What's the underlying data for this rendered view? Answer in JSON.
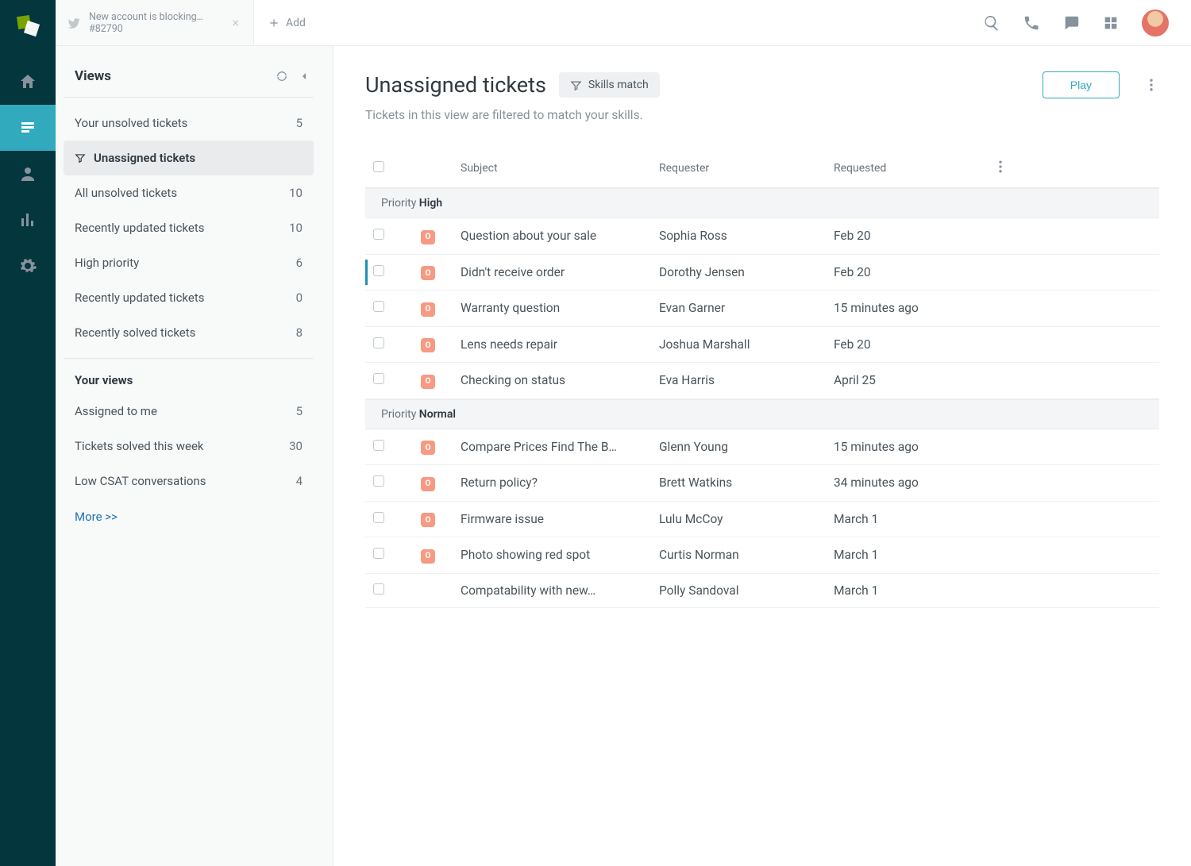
{
  "tab": {
    "title": "New account is blocking…",
    "subtitle": "#82790",
    "add_label": "Add"
  },
  "views_panel": {
    "heading": "Views",
    "system_views": [
      {
        "label": "Your unsolved tickets",
        "count": "5",
        "selected": false,
        "icon": false
      },
      {
        "label": "Unassigned tickets",
        "count": "",
        "selected": true,
        "icon": true
      },
      {
        "label": "All unsolved tickets",
        "count": "10",
        "selected": false,
        "icon": false
      },
      {
        "label": "Recently updated tickets",
        "count": "10",
        "selected": false,
        "icon": false
      },
      {
        "label": "High priority",
        "count": "6",
        "selected": false,
        "icon": false
      },
      {
        "label": "Recently updated tickets",
        "count": "0",
        "selected": false,
        "icon": false
      },
      {
        "label": "Recently solved tickets",
        "count": "8",
        "selected": false,
        "icon": false
      }
    ],
    "your_views_heading": "Your views",
    "your_views": [
      {
        "label": "Assigned to me",
        "count": "5"
      },
      {
        "label": "Tickets solved this week",
        "count": "30"
      },
      {
        "label": "Low CSAT conversations",
        "count": "4"
      }
    ],
    "more_label": "More >>"
  },
  "main": {
    "title": "Unassigned tickets",
    "skills_label": "Skills match",
    "play_label": "Play",
    "subtitle": "Tickets in this view are filtered to match your skills.",
    "columns": {
      "subject": "Subject",
      "requester": "Requester",
      "requested": "Requested"
    },
    "priority_label": "Priority",
    "groups": [
      {
        "name": "High",
        "rows": [
          {
            "badge": "O",
            "subject": "Question about your sale",
            "requester": "Sophia Ross",
            "requested": "Feb 20",
            "marked": false
          },
          {
            "badge": "O",
            "subject": "Didn't receive order",
            "requester": "Dorothy Jensen",
            "requested": "Feb 20",
            "marked": true
          },
          {
            "badge": "O",
            "subject": "Warranty question",
            "requester": "Evan Garner",
            "requested": "15 minutes ago",
            "marked": false
          },
          {
            "badge": "O",
            "subject": "Lens needs repair",
            "requester": "Joshua Marshall",
            "requested": "Feb 20",
            "marked": false
          },
          {
            "badge": "O",
            "subject": "Checking on status",
            "requester": "Eva Harris",
            "requested": "April 25",
            "marked": false
          }
        ]
      },
      {
        "name": "Normal",
        "rows": [
          {
            "badge": "O",
            "subject": "Compare Prices Find The B…",
            "requester": "Glenn Young",
            "requested": "15 minutes ago",
            "marked": false
          },
          {
            "badge": "O",
            "subject": "Return policy?",
            "requester": "Brett Watkins",
            "requested": "34 minutes ago",
            "marked": false
          },
          {
            "badge": "O",
            "subject": "Firmware issue",
            "requester": "Lulu McCoy",
            "requested": "March 1",
            "marked": false
          },
          {
            "badge": "O",
            "subject": "Photo showing red spot",
            "requester": "Curtis Norman",
            "requested": "March 1",
            "marked": false
          },
          {
            "badge": "",
            "subject": "Compatability with new…",
            "requester": "Polly Sandoval",
            "requested": "March 1",
            "marked": false
          }
        ]
      }
    ]
  }
}
